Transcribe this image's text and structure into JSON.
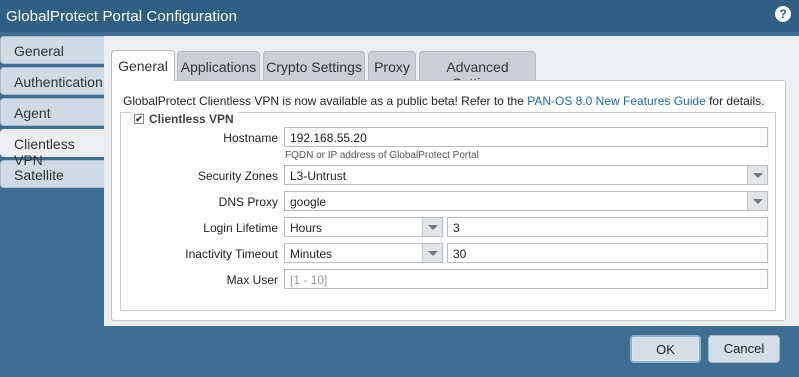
{
  "window": {
    "title": "GlobalProtect Portal Configuration"
  },
  "sidebar": {
    "items": [
      {
        "label": "General",
        "active": false
      },
      {
        "label": "Authentication",
        "active": false
      },
      {
        "label": "Agent",
        "active": false
      },
      {
        "label": "Clientless VPN",
        "active": true
      },
      {
        "label": "Satellite",
        "active": false
      }
    ]
  },
  "tabs": [
    {
      "label": "General",
      "active": true
    },
    {
      "label": "Applications",
      "active": false
    },
    {
      "label": "Crypto Settings",
      "active": false
    },
    {
      "label": "Proxy",
      "active": false
    },
    {
      "label": "Advanced Settings",
      "active": false
    }
  ],
  "notice": {
    "prefix": "GlobalProtect Clientless VPN is now available as a public beta! Refer to the ",
    "link": "PAN-OS 8.0 New Features Guide",
    "suffix": " for details."
  },
  "clientless": {
    "legend": "Clientless VPN",
    "checked": true,
    "check_glyph": "✔",
    "hostname": {
      "label": "Hostname",
      "value": "192.168.55.20",
      "helper": "FQDN or IP address of GlobalProtect Portal"
    },
    "security_zones": {
      "label": "Security Zones",
      "value": "L3-Untrust"
    },
    "dns_proxy": {
      "label": "DNS Proxy",
      "value": "google"
    },
    "login_lifetime": {
      "label": "Login Lifetime",
      "unit": "Hours",
      "value": "3"
    },
    "inactivity_timeout": {
      "label": "Inactivity Timeout",
      "unit": "Minutes",
      "value": "30"
    },
    "max_user": {
      "label": "Max User",
      "placeholder": "[1 - 10]"
    }
  },
  "buttons": {
    "ok": "OK",
    "cancel": "Cancel"
  },
  "icons": {
    "help": "?"
  }
}
